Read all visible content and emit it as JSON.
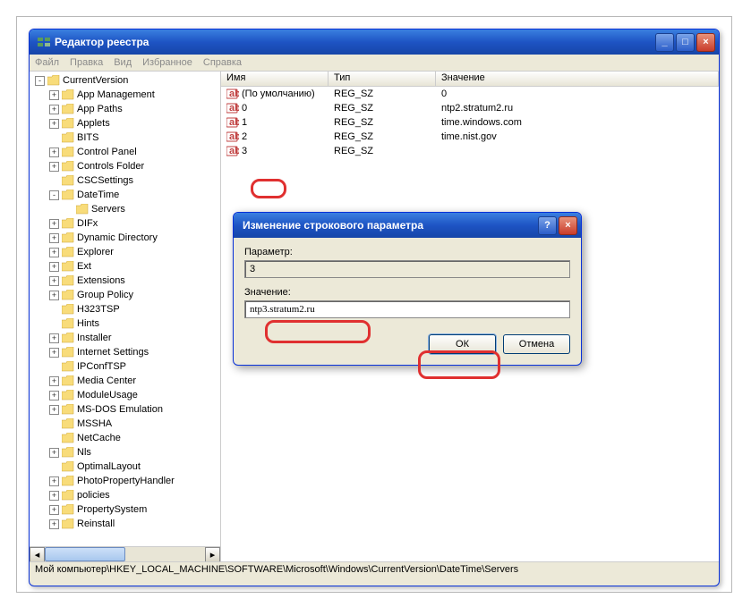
{
  "window": {
    "title": "Редактор реестра"
  },
  "menubar": [
    "Файл",
    "Правка",
    "Вид",
    "Избранное",
    "Справка"
  ],
  "tree": [
    {
      "indent": 0,
      "exp": "-",
      "label": "CurrentVersion"
    },
    {
      "indent": 1,
      "exp": "+",
      "label": "App Management"
    },
    {
      "indent": 1,
      "exp": "+",
      "label": "App Paths"
    },
    {
      "indent": 1,
      "exp": "+",
      "label": "Applets"
    },
    {
      "indent": 1,
      "exp": " ",
      "label": "BITS"
    },
    {
      "indent": 1,
      "exp": "+",
      "label": "Control Panel"
    },
    {
      "indent": 1,
      "exp": "+",
      "label": "Controls Folder"
    },
    {
      "indent": 1,
      "exp": " ",
      "label": "CSCSettings"
    },
    {
      "indent": 1,
      "exp": "-",
      "label": "DateTime"
    },
    {
      "indent": 2,
      "exp": " ",
      "label": "Servers"
    },
    {
      "indent": 1,
      "exp": "+",
      "label": "DIFx"
    },
    {
      "indent": 1,
      "exp": "+",
      "label": "Dynamic Directory"
    },
    {
      "indent": 1,
      "exp": "+",
      "label": "Explorer"
    },
    {
      "indent": 1,
      "exp": "+",
      "label": "Ext"
    },
    {
      "indent": 1,
      "exp": "+",
      "label": "Extensions"
    },
    {
      "indent": 1,
      "exp": "+",
      "label": "Group Policy"
    },
    {
      "indent": 1,
      "exp": " ",
      "label": "H323TSP"
    },
    {
      "indent": 1,
      "exp": " ",
      "label": "Hints"
    },
    {
      "indent": 1,
      "exp": "+",
      "label": "Installer"
    },
    {
      "indent": 1,
      "exp": "+",
      "label": "Internet Settings"
    },
    {
      "indent": 1,
      "exp": " ",
      "label": "IPConfTSP"
    },
    {
      "indent": 1,
      "exp": "+",
      "label": "Media Center"
    },
    {
      "indent": 1,
      "exp": "+",
      "label": "ModuleUsage"
    },
    {
      "indent": 1,
      "exp": "+",
      "label": "MS-DOS Emulation"
    },
    {
      "indent": 1,
      "exp": " ",
      "label": "MSSHA"
    },
    {
      "indent": 1,
      "exp": " ",
      "label": "NetCache"
    },
    {
      "indent": 1,
      "exp": "+",
      "label": "Nls"
    },
    {
      "indent": 1,
      "exp": " ",
      "label": "OptimalLayout"
    },
    {
      "indent": 1,
      "exp": "+",
      "label": "PhotoPropertyHandler"
    },
    {
      "indent": 1,
      "exp": "+",
      "label": "policies"
    },
    {
      "indent": 1,
      "exp": "+",
      "label": "PropertySystem"
    },
    {
      "indent": 1,
      "exp": "+",
      "label": "Reinstall"
    }
  ],
  "list": {
    "headers": {
      "name": "Имя",
      "type": "Тип",
      "value": "Значение"
    },
    "rows": [
      {
        "name": "(По умолчанию)",
        "type": "REG_SZ",
        "value": "0"
      },
      {
        "name": "0",
        "type": "REG_SZ",
        "value": "ntp2.stratum2.ru"
      },
      {
        "name": "1",
        "type": "REG_SZ",
        "value": "time.windows.com"
      },
      {
        "name": "2",
        "type": "REG_SZ",
        "value": "time.nist.gov"
      },
      {
        "name": "3",
        "type": "REG_SZ",
        "value": ""
      }
    ]
  },
  "statusbar": "Мой компьютер\\HKEY_LOCAL_MACHINE\\SOFTWARE\\Microsoft\\Windows\\CurrentVersion\\DateTime\\Servers",
  "dialog": {
    "title": "Изменение строкового параметра",
    "param_label": "Параметр:",
    "param_value": "3",
    "value_label": "Значение:",
    "value_input": "ntp3.stratum2.ru",
    "ok": "ОК",
    "cancel": "Отмена"
  }
}
